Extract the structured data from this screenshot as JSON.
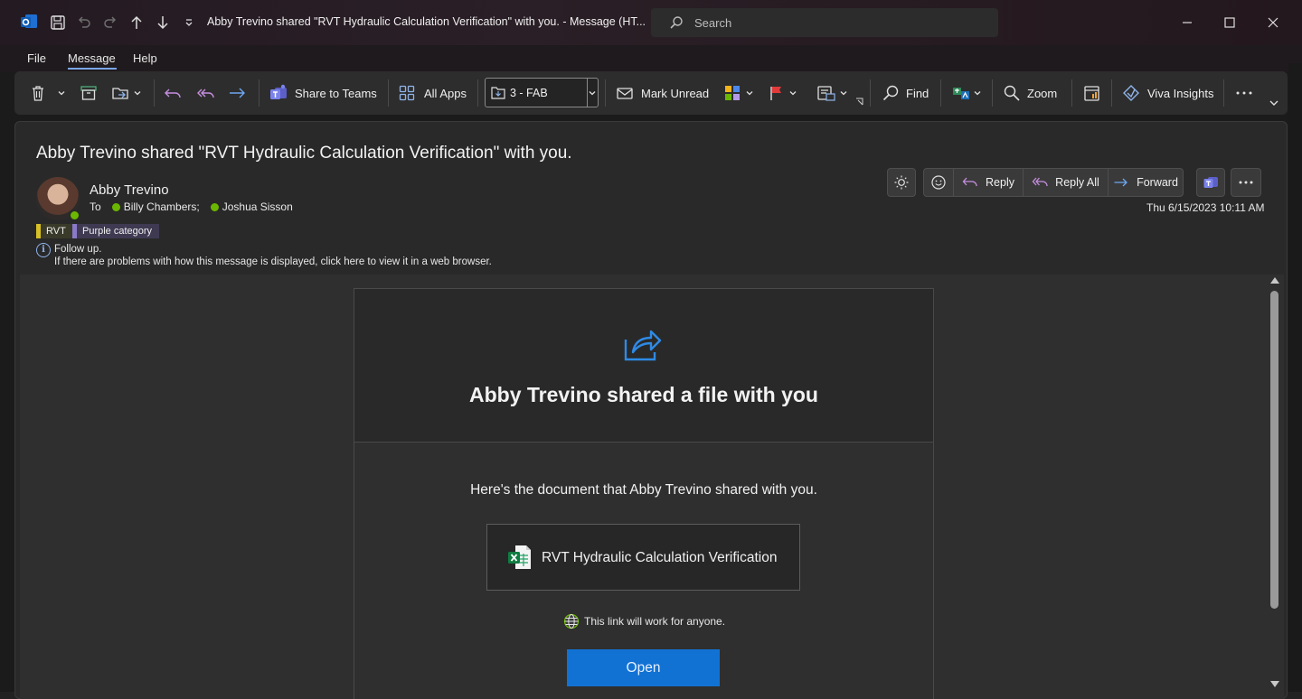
{
  "window": {
    "title": "Abby Trevino shared \"RVT Hydraulic Calculation Verification\" with you.  -  Message (HT...",
    "search_placeholder": "Search"
  },
  "menu": {
    "file": "File",
    "message": "Message",
    "help": "Help",
    "active": "Message"
  },
  "ribbon": {
    "share_to_teams": "Share to Teams",
    "all_apps": "All Apps",
    "folder": "3 - FAB",
    "mark_unread": "Mark Unread",
    "find": "Find",
    "zoom": "Zoom",
    "viva_insights": "Viva Insights"
  },
  "message": {
    "subject": "Abby Trevino shared \"RVT Hydraulic Calculation Verification\" with you.",
    "sender": "Abby Trevino",
    "to_label": "To",
    "recipients": [
      "Billy Chambers;",
      "Joshua Sisson"
    ],
    "categories": [
      "RVT",
      "Purple category"
    ],
    "category_colors": [
      "#d7c126",
      "#8a78c8"
    ],
    "follow_up": "Follow up.",
    "web_note": "If there are problems with how this message is displayed, click here to view it in a web browser.",
    "datetime": "Thu 6/15/2023 10:11 AM",
    "actions": {
      "reply": "Reply",
      "reply_all": "Reply All",
      "forward": "Forward"
    }
  },
  "share_card": {
    "title": "Abby Trevino shared a file with you",
    "description": "Here's the document that Abby Trevino shared with you.",
    "file_name": "RVT Hydraulic Calculation Verification",
    "link_note": "This link will work for anyone.",
    "open_label": "Open",
    "accent": "#1172d4"
  }
}
